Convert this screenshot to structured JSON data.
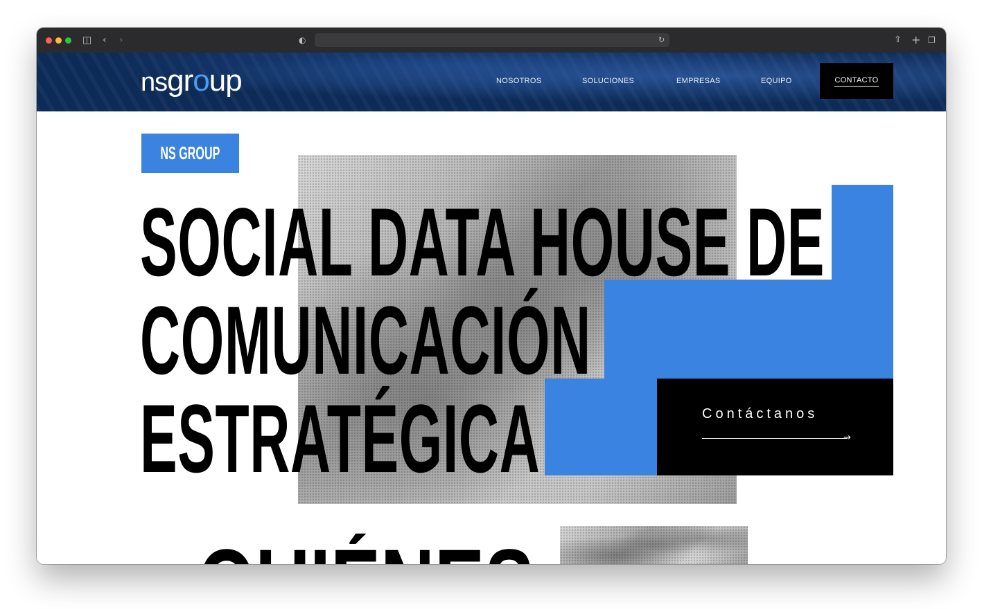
{
  "browser": {
    "url": "",
    "icons": [
      "sidebar-icon",
      "back-icon",
      "forward-icon",
      "shield-icon",
      "reload-icon",
      "share-icon",
      "new-tab-icon",
      "tabs-overview-icon"
    ]
  },
  "header": {
    "logo": {
      "ns": "NS",
      "group_pre": "gr",
      "group_o": "o",
      "group_post": "up"
    },
    "nav": [
      "NOSOTROS",
      "SOLUCIONES",
      "EMPRESAS",
      "EQUIPO",
      "CONTACTO"
    ],
    "active_nav": "CONTACTO"
  },
  "hero": {
    "badge": "NS GROUP",
    "headline": [
      "SOCIAL DATA HOUSE DE",
      "COMUNICACIÓN",
      "ESTRATÉGICA"
    ],
    "cta": "Contáctanos"
  },
  "next_section": {
    "heading": "QUIÉNES"
  },
  "colors": {
    "accent": "#3a83e0",
    "header_bg": "#0d2b57",
    "dark": "#000000"
  }
}
